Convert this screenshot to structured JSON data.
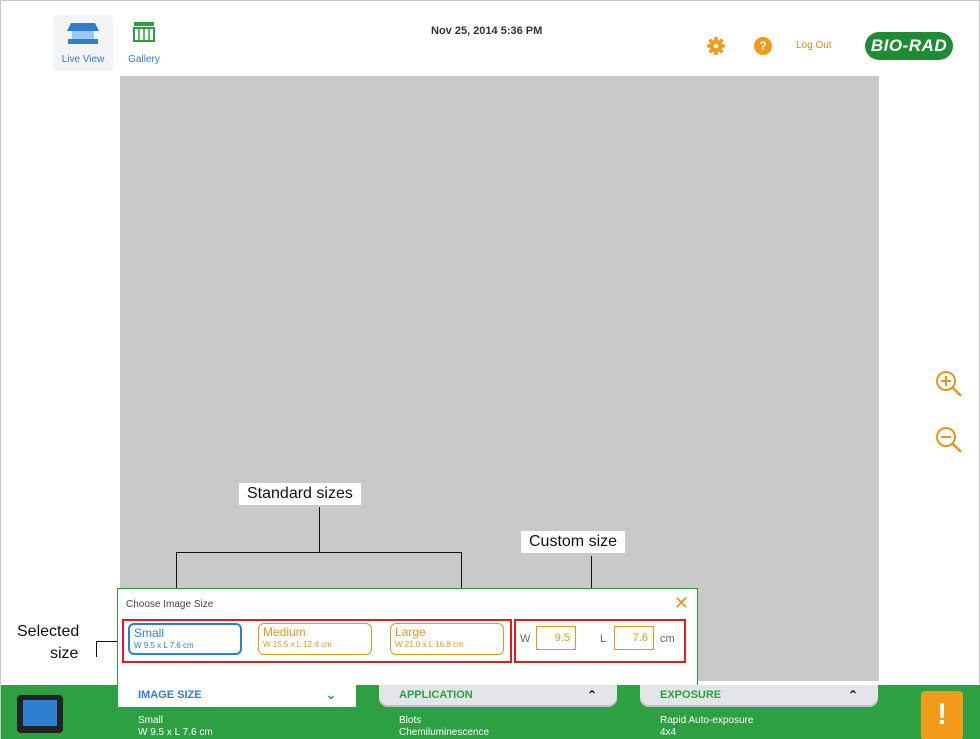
{
  "header": {
    "nav": [
      {
        "label": "Live View",
        "icon": "live-view-icon"
      },
      {
        "label": "Gallery",
        "icon": "gallery-icon"
      }
    ],
    "datetime": "Nov 25, 2014   5:36 PM",
    "logout_label": "Log Out",
    "logo_text": "BIO-RAD",
    "help_icon": "?"
  },
  "callouts": {
    "standard": "Standard sizes",
    "custom": "Custom size",
    "selected_line1": "Selected",
    "selected_line2": "size"
  },
  "size_panel": {
    "title": "Choose Image Size",
    "close_icon": "✕",
    "options": [
      {
        "name": "Small",
        "dims": "W 9.5 x L 7.6 cm",
        "selected": true
      },
      {
        "name": "Medium",
        "dims": "W 15.5 x L 12.4 cm",
        "selected": false
      },
      {
        "name": "Large",
        "dims": "W 21.0 x L 16.8 cm",
        "selected": false
      }
    ],
    "custom": {
      "w_label": "W",
      "w_value": "9.5",
      "l_label": "L",
      "l_value": "7.6",
      "unit": "cm"
    }
  },
  "bottom_bar": {
    "tabs": [
      {
        "title": "IMAGE SIZE",
        "line1": "Small",
        "line2": "W 9.5 x L 7.6 cm",
        "arrow": "⌄"
      },
      {
        "title": "APPLICATION",
        "line1": "Blots",
        "line2": "Chemiluminescence",
        "arrow": "⌃"
      },
      {
        "title": "EXPOSURE",
        "line1": "Rapid Auto-exposure",
        "line2": "4x4",
        "arrow": "⌃"
      }
    ],
    "alert_symbol": "!"
  },
  "colors": {
    "accent_green": "#2ea044",
    "accent_orange": "#e8961c",
    "accent_blue": "#2e7fd0",
    "highlight_red": "#e41b1b"
  }
}
